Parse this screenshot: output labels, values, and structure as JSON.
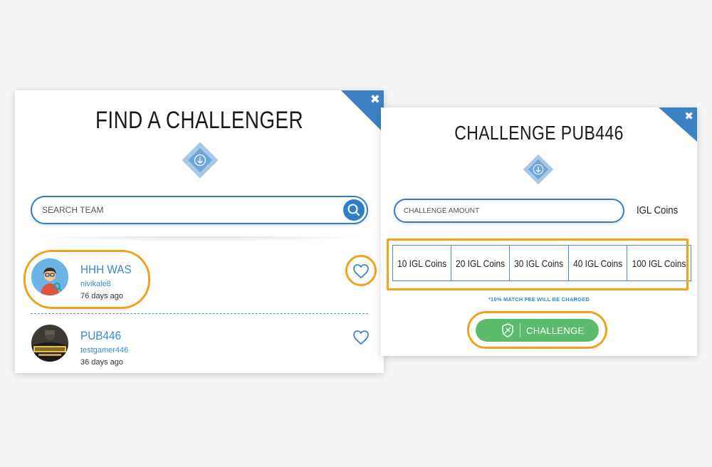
{
  "find_modal": {
    "title": "FIND A CHALLENGER",
    "search_placeholder": "SEARCH TEAM",
    "teams": [
      {
        "name": "HHH WAS",
        "username": "nivikale8",
        "time": "76 days ago"
      },
      {
        "name": "PUB446",
        "username": "testgamer446",
        "time": "36 days ago"
      }
    ]
  },
  "challenge_modal": {
    "title": "CHALLENGE PUB446",
    "amount_placeholder": "CHALLENGE AMOUNT",
    "currency_label": "IGL Coins",
    "coin_options": [
      "10 IGL Coins",
      "20 IGL Coins",
      "30 IGL Coins",
      "40 IGL Coins",
      "100 IGL Coins"
    ],
    "fee_note": "*10% MATCH FEE WILL BE CHARGED",
    "challenge_button": "CHALLENGE"
  },
  "colors": {
    "accent_blue": "#2f7ec8",
    "corner_blue": "#3b82c4",
    "highlight_orange": "#f2a01d",
    "challenge_green": "#5bbd6b"
  },
  "icons": {
    "close": "close-icon",
    "arrow": "arrow-down-icon",
    "search": "search-icon",
    "favorite": "heart-icon",
    "challenge": "shield-icon"
  }
}
